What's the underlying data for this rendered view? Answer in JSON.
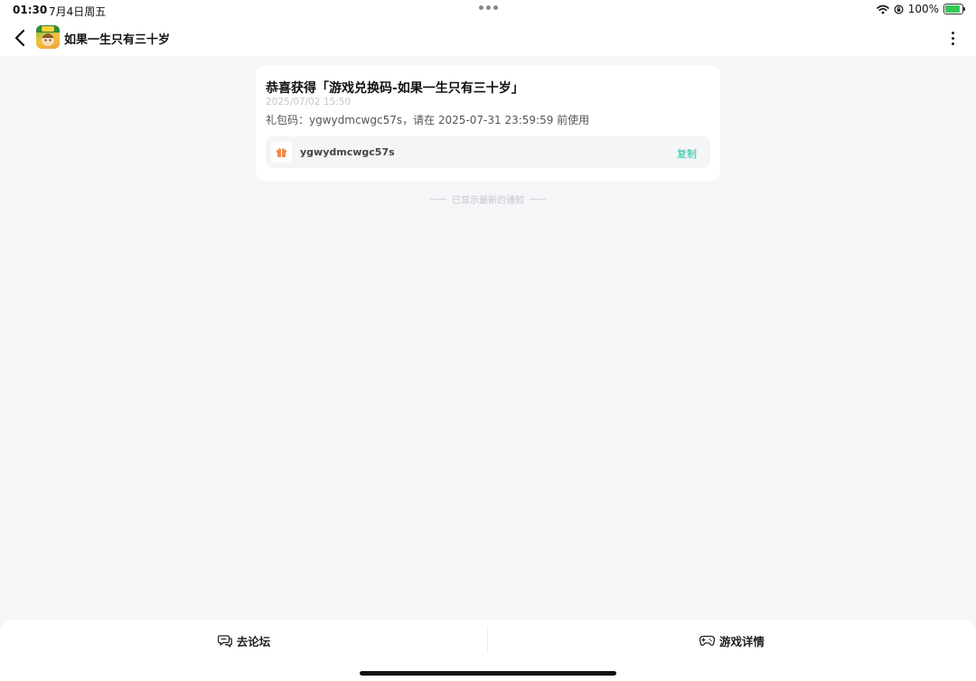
{
  "status_bar": {
    "time": "01:30",
    "date": "7月4日周五",
    "battery": "100%",
    "battery_level": 1.0
  },
  "nav": {
    "title": "如果一生只有三十岁"
  },
  "notification": {
    "title": "恭喜获得「游戏兑换码-如果一生只有三十岁」",
    "time": "2025/07/02 15:50",
    "description": "礼包码：ygwydmcwgc57s，请在 2025-07-31 23:59:59 前使用",
    "code": "ygwydmcwgc57s",
    "copy_label": "复制"
  },
  "end_note": "已显示最新的通知",
  "bottom": {
    "forum_label": "去论坛",
    "game_detail_label": "游戏详情"
  },
  "colors": {
    "accent": "#16c3a5",
    "gift": "#f08a4b",
    "battery": "#34c759"
  }
}
